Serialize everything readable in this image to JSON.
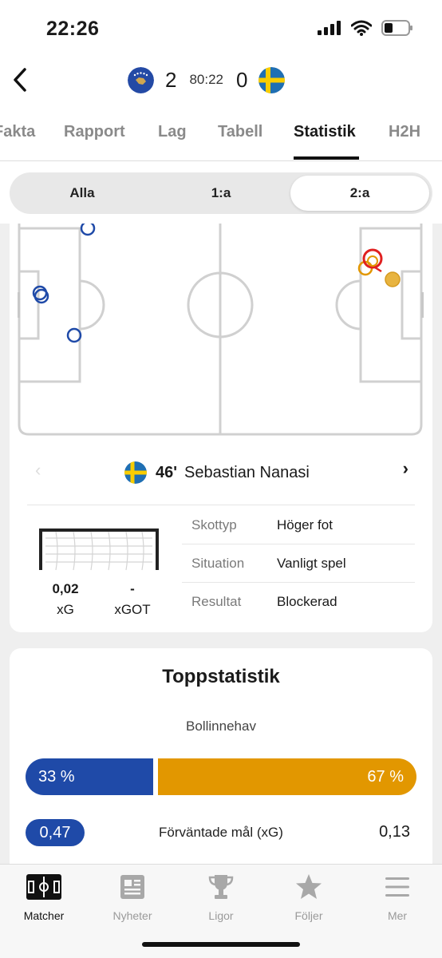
{
  "status_bar": {
    "time": "22:26"
  },
  "match": {
    "home_score": "2",
    "clock": "80:22",
    "away_score": "0",
    "home_flag_icon": "kosovo-flag-icon",
    "away_flag_icon": "sweden-flag-icon"
  },
  "tabs": [
    {
      "label": "Fakta"
    },
    {
      "label": "Rapport"
    },
    {
      "label": "Lag"
    },
    {
      "label": "Tabell"
    },
    {
      "label": "Statistik",
      "active": true
    },
    {
      "label": "H2H"
    }
  ],
  "periods": [
    {
      "label": "Alla"
    },
    {
      "label": "1:a"
    },
    {
      "label": "2:a",
      "active": true
    }
  ],
  "shot": {
    "minute": "46'",
    "player": "Sebastian Nanasi",
    "xg_value": "0,02",
    "xg_label": "xG",
    "xgot_value": "-",
    "xgot_label": "xGOT",
    "details": [
      {
        "label": "Skottyp",
        "value": "Höger fot"
      },
      {
        "label": "Situation",
        "value": "Vanligt spel"
      },
      {
        "label": "Resultat",
        "value": "Blockerad"
      }
    ]
  },
  "top_stats": {
    "title": "Toppstatistik",
    "possession_label": "Bollinnehav",
    "home_possession": "33 %",
    "away_possession": "67 %",
    "home_possession_share": 0.33,
    "xg_label": "Förväntade mål (xG)",
    "home_xg": "0,47",
    "away_xg": "0,13"
  },
  "bottom_nav": [
    {
      "label": "Matcher",
      "icon": "pitch-icon",
      "active": true
    },
    {
      "label": "Nyheter",
      "icon": "newspaper-icon"
    },
    {
      "label": "Ligor",
      "icon": "trophy-icon"
    },
    {
      "label": "Följer",
      "icon": "star-icon"
    },
    {
      "label": "Mer",
      "icon": "menu-icon"
    }
  ],
  "colors": {
    "home": "#1f4aa8",
    "away": "#e29700",
    "highlight": "#e02020"
  }
}
